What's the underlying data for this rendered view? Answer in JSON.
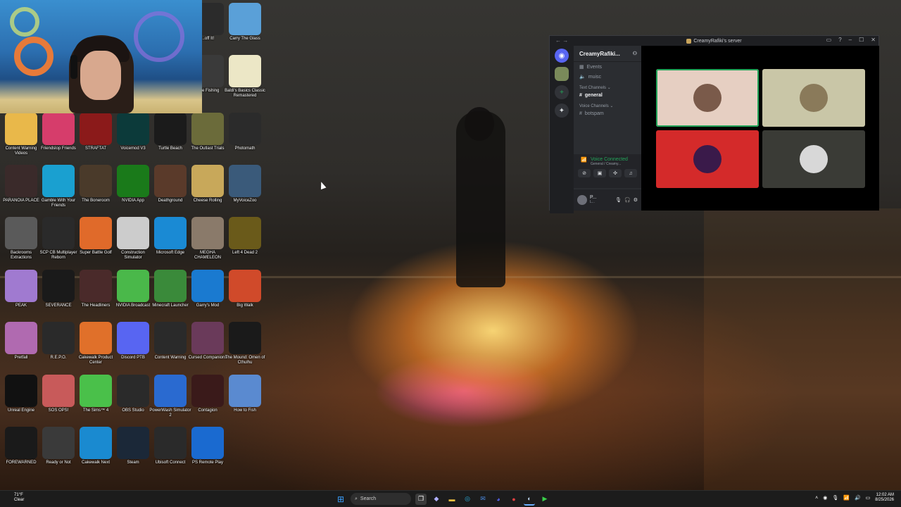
{
  "desktop_icons": [
    {
      "label": "...off It!",
      "color": "#2b2b2b"
    },
    {
      "label": "Carry The Glass",
      "color": "#5aa0d8"
    },
    {
      "label": "...ne Fishing",
      "color": "#3a3a3a"
    },
    {
      "label": "Baldi's Basics Classic Remastered",
      "color": "#ece7c6"
    },
    {
      "label": "Content Warning Videos",
      "color": "#e9b84a"
    },
    {
      "label": "Friendslop Friends",
      "color": "#d63d6b"
    },
    {
      "label": "STRAFTAT",
      "color": "#8b1a1a"
    },
    {
      "label": "Voicemod V3",
      "color": "#0c3a3a"
    },
    {
      "label": "Turtle Beach",
      "color": "#1b1b1b"
    },
    {
      "label": "The Outlast Trials",
      "color": "#6b6b3a"
    },
    {
      "label": "Photomath",
      "color": "#2b2b2b"
    },
    {
      "label": "PARANOIA PLACE",
      "color": "#3a2a2a"
    },
    {
      "label": "Gamble With Your Friends",
      "color": "#1aa0d0"
    },
    {
      "label": "The Boneroom",
      "color": "#4a3a2a"
    },
    {
      "label": "NVIDIA App",
      "color": "#1a7a1a"
    },
    {
      "label": "Deathground",
      "color": "#5a3a2a"
    },
    {
      "label": "Cheese Rolling",
      "color": "#c8a85a"
    },
    {
      "label": "MyVoiceZoo",
      "color": "#3a5a7a"
    },
    {
      "label": "Backrooms Extractions",
      "color": "#5a5a5a"
    },
    {
      "label": "SCP CB Multiplayer Reborn",
      "color": "#2a2a2a"
    },
    {
      "label": "Super Battle Golf",
      "color": "#e06a2a"
    },
    {
      "label": "Construction Simulator",
      "color": "#cccccc"
    },
    {
      "label": "Microsoft Edge",
      "color": "#1a8ad4"
    },
    {
      "label": "MEGHA CHAMELEON",
      "color": "#8a7a6a"
    },
    {
      "label": "Left 4 Dead 2",
      "color": "#6a5a1a"
    },
    {
      "label": "PEAK",
      "color": "#a07ad0"
    },
    {
      "label": "SEVERANCE",
      "color": "#1a1a1a"
    },
    {
      "label": "The Headliners",
      "color": "#4a2a2a"
    },
    {
      "label": "NVIDIA Broadcast",
      "color": "#4ab84a"
    },
    {
      "label": "Minecraft Launcher",
      "color": "#3a8a3a"
    },
    {
      "label": "Garry's Mod",
      "color": "#1a7ad0"
    },
    {
      "label": "Big Walk",
      "color": "#d04a2a"
    },
    {
      "label": "Pretfall",
      "color": "#b06ab0"
    },
    {
      "label": "R.E.P.O.",
      "color": "#2a2a2a"
    },
    {
      "label": "Cakewalk Product Center",
      "color": "#e0702a"
    },
    {
      "label": "Discord PTB",
      "color": "#5865f2"
    },
    {
      "label": "Content Warning",
      "color": "#2a2a2a"
    },
    {
      "label": "Cursed Companions",
      "color": "#6a3a5a"
    },
    {
      "label": "The Mound: Omen of Cthulhu",
      "color": "#1a1a1a"
    },
    {
      "label": "Unreal Engine",
      "color": "#111111"
    },
    {
      "label": "SOS OPS!",
      "color": "#c85a5a"
    },
    {
      "label": "The Sims™ 4",
      "color": "#4ac04a"
    },
    {
      "label": "OBS Studio",
      "color": "#2a2a2a"
    },
    {
      "label": "PowerWash Simulator 2",
      "color": "#2a6ad0"
    },
    {
      "label": "Contagion",
      "color": "#3a1a1a"
    },
    {
      "label": "How to Fish",
      "color": "#5a8ad0"
    },
    {
      "label": "FOREWARNED",
      "color": "#1a1a1a"
    },
    {
      "label": "Ready or Not",
      "color": "#3a3a3a"
    },
    {
      "label": "Cakewalk Next",
      "color": "#1a8ad0"
    },
    {
      "label": "Steam",
      "color": "#1b2838"
    },
    {
      "label": "Ubisoft Connect",
      "color": "#2a2a2a"
    },
    {
      "label": "PS Remote Play",
      "color": "#1a6ad0"
    }
  ],
  "discord": {
    "window_title": "CreamyRafiki's server",
    "server_name": "CreamyRafiki...",
    "channels": {
      "events": "Events",
      "music": "muisc",
      "text_category": "Text Channels",
      "general": "general",
      "voice_category": "Voice Channels",
      "botspam": "botspam"
    },
    "voice": {
      "status": "Voice Connected",
      "location": "General / Creamy..."
    },
    "user": {
      "name": "P...",
      "status": "L..."
    },
    "tiles": [
      {
        "bg": "#e6cfc2",
        "avatar": "#7a5a4a",
        "speaking": true
      },
      {
        "bg": "#c9c6a7",
        "avatar": "#8a7a5a",
        "speaking": false
      },
      {
        "bg": "#d42a2a",
        "avatar": "#3a1a4a",
        "speaking": false
      },
      {
        "bg": "#3a3b36",
        "avatar": "#d8d8d8",
        "speaking": false
      }
    ]
  },
  "taskbar": {
    "weather_temp": "71°F",
    "weather_desc": "Clear",
    "search_placeholder": "Search",
    "time": "12:02 AM",
    "date": "8/25/2026"
  }
}
